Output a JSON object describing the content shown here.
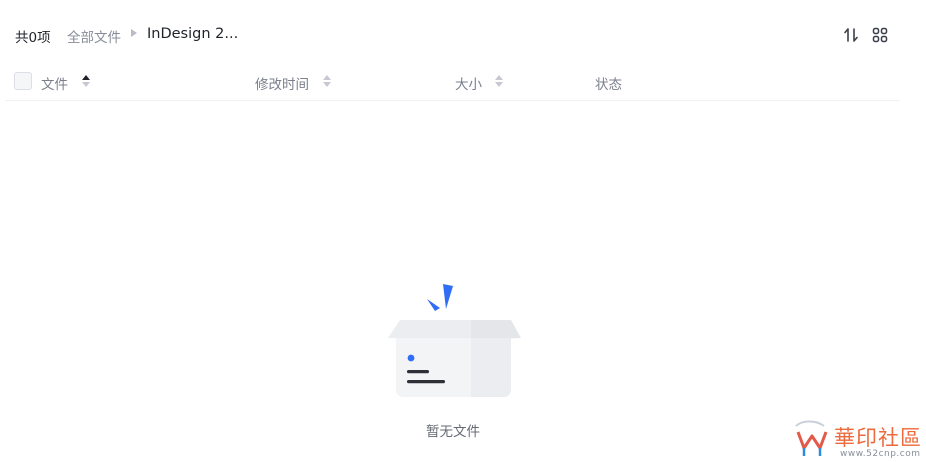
{
  "header": {
    "item_count": "共0项",
    "breadcrumb_root": "全部文件",
    "breadcrumb_current": "InDesign 2..."
  },
  "table": {
    "columns": {
      "name": "文件",
      "modified": "修改时间",
      "size": "大小",
      "status": "状态"
    },
    "sort": {
      "column": "name",
      "direction": "ascending"
    }
  },
  "empty_state": {
    "message": "暂无文件"
  },
  "watermark": {
    "text": "華印社區",
    "url": "www.52cnp.com"
  },
  "icons": {
    "sort_order": "sort-order-icon",
    "grid_view": "grid-view-icon",
    "empty_box": "empty-box-icon",
    "logo": "logo-icon"
  },
  "colors": {
    "accent_blue": "#2f6ef5",
    "text_primary": "#1f2329",
    "text_secondary": "#878c99",
    "watermark_orange": "#ec6a3c"
  }
}
